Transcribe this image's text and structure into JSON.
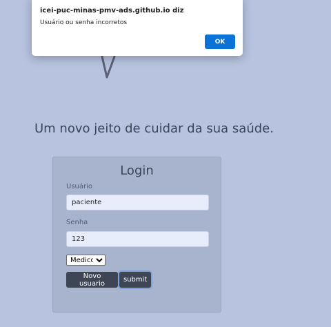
{
  "page": {
    "tagline": "Um novo jeito de cuidar da sua saúde."
  },
  "login": {
    "title": "Login",
    "username_label": "Usuário",
    "username_value": "paciente",
    "password_label": "Senha",
    "password_value": "123",
    "role_selected": "Medico",
    "new_user_label": "Novo usuario",
    "submit_label": "submit"
  },
  "alert": {
    "origin": "icei-puc-minas-pmv-ads.github.io diz",
    "message": "Usuário ou senha incorretos",
    "ok_label": "OK"
  },
  "colors": {
    "page_background": "#b7c3df",
    "card_background": "#a8b3ce",
    "button_dark": "#3e4656",
    "alert_ok_blue": "#0b73d5"
  }
}
